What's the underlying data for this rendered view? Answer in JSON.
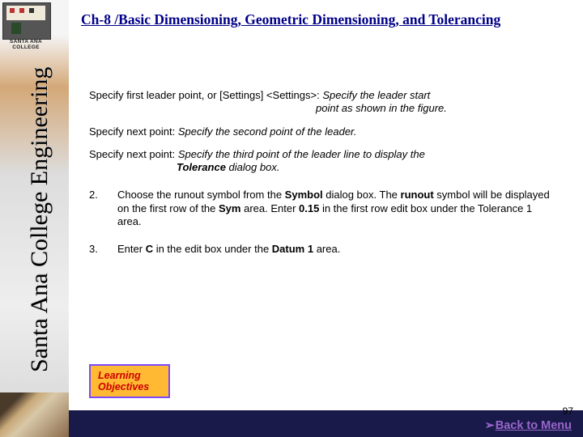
{
  "sidebar": {
    "college_label": "SANTA ANA COLLEGE",
    "vertical_title": "Santa Ana College Engineering"
  },
  "header": {
    "title": "Ch-8 /Basic Dimensioning, Geometric Dimensioning, and Tolerancing"
  },
  "content": {
    "p1_a": "Specify first leader point, or [Settings] <Settings>: ",
    "p1_b": "Specify the leader start",
    "p1_c": "point as shown in the figure.",
    "p2_a": "Specify next point: ",
    "p2_b": "Specify the second point of the leader.",
    "p3_a": "Specify next point: ",
    "p3_b": "Specify the third point of the leader line to display the",
    "p3_c": "Tolerance",
    "p3_d": " dialog box.",
    "step2_num": "2.",
    "step2_a": "Choose the runout symbol from the ",
    "step2_b": "Symbol",
    "step2_c": " dialog box. The ",
    "step2_d": "runout",
    "step2_e": " symbol will be displayed on the first row of the ",
    "step2_f": "Sym",
    "step2_g": " area. Enter ",
    "step2_h": "0.15",
    "step2_i": " in the first row edit box under the Tolerance 1 area.",
    "step3_num": "3.",
    "step3_a": "Enter ",
    "step3_b": "C",
    "step3_c": " in the edit box under the ",
    "step3_d": "Datum 1",
    "step3_e": " area."
  },
  "learning": {
    "line1": "Learning",
    "line2": "Objectives"
  },
  "footer": {
    "page": "97",
    "arrow": "➢",
    "back": "Back to Menu"
  }
}
